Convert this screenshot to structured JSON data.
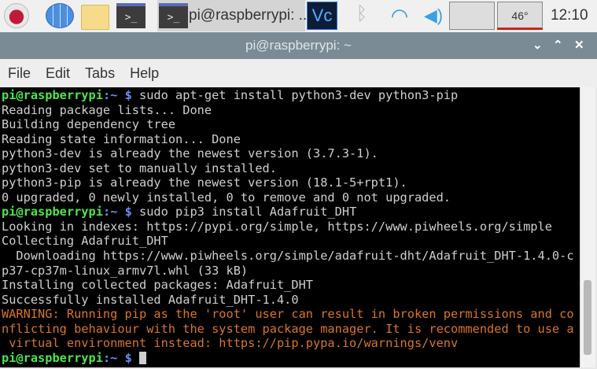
{
  "taskbar": {
    "task_label": "pi@raspberrypi: ...",
    "temperature": "46°",
    "clock": "12:10",
    "icons": [
      "raspberry-menu-icon",
      "browser-globe-icon",
      "file-manager-icon",
      "terminal-icon",
      "vnc-icon",
      "bluetooth-icon",
      "wifi-icon",
      "volume-icon",
      "cpu-monitor-icon",
      "temperature-monitor-icon"
    ]
  },
  "window": {
    "title": "pi@raspberrypi: ~"
  },
  "menu": [
    "File",
    "Edit",
    "Tabs",
    "Help"
  ],
  "terminal": {
    "prompt_user": "pi@raspberrypi",
    "prompt_path": ":~ $",
    "lines": [
      {
        "type": "cmd",
        "text": " sudo apt-get install python3-dev python3-pip"
      },
      {
        "type": "out",
        "text": "Reading package lists... Done"
      },
      {
        "type": "out",
        "text": "Building dependency tree"
      },
      {
        "type": "out",
        "text": "Reading state information... Done"
      },
      {
        "type": "out",
        "text": "python3-dev is already the newest version (3.7.3-1)."
      },
      {
        "type": "out",
        "text": "python3-dev set to manually installed."
      },
      {
        "type": "out",
        "text": "python3-pip is already the newest version (18.1-5+rpt1)."
      },
      {
        "type": "out",
        "text": "0 upgraded, 0 newly installed, 0 to remove and 0 not upgraded."
      },
      {
        "type": "cmd",
        "text": " sudo pip3 install Adafruit_DHT"
      },
      {
        "type": "out",
        "text": "Looking in indexes: https://pypi.org/simple, https://www.piwheels.org/simple"
      },
      {
        "type": "out",
        "text": "Collecting Adafruit_DHT"
      },
      {
        "type": "out",
        "text": "  Downloading https://www.piwheels.org/simple/adafruit-dht/Adafruit_DHT-1.4.0-c"
      },
      {
        "type": "out",
        "text": "p37-cp37m-linux_armv7l.whl (33 kB)"
      },
      {
        "type": "out",
        "text": "Installing collected packages: Adafruit_DHT"
      },
      {
        "type": "out",
        "text": "Successfully installed Adafruit_DHT-1.4.0"
      },
      {
        "type": "warn",
        "text": "WARNING: Running pip as the 'root' user can result in broken permissions and co"
      },
      {
        "type": "warn",
        "text": "nflicting behaviour with the system package manager. It is recommended to use a"
      },
      {
        "type": "warn",
        "text": " virtual environment instead: https://pip.pypa.io/warnings/venv"
      },
      {
        "type": "cmd",
        "text": " "
      }
    ]
  }
}
